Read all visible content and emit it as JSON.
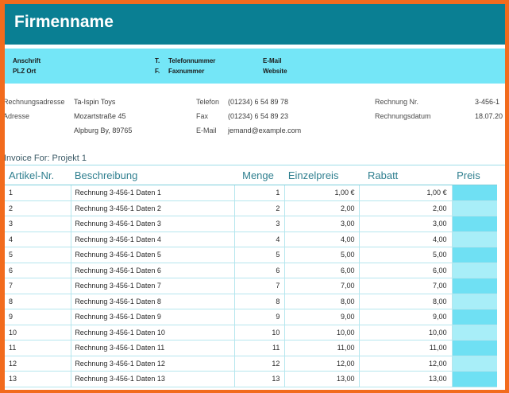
{
  "header": {
    "company_name": "Firmenname"
  },
  "contact": {
    "anschrift": "Anschrift",
    "plz_ort": "PLZ Ort",
    "t_label": "T.",
    "telefonnummer": "Telefonnummer",
    "f_label": "F.",
    "faxnummer": "Faxnummer",
    "email": "E-Mail",
    "website": "Website"
  },
  "billing": {
    "rechnungsadresse_label": "Rechnungsadresse",
    "adresse_label": "Adresse",
    "name": "Ta-Ispin Toys",
    "street": "Mozartstraße 45",
    "city": "Alpburg By, 89765",
    "telefon_label": "Telefon",
    "telefon_value": "(01234) 6 54 89 78",
    "fax_label": "Fax",
    "fax_value": "(01234) 6 54 89 23",
    "email_label": "E-Mail",
    "email_value": "jemand@example.com",
    "rechnung_nr_label": "Rechnung Nr.",
    "rechnung_nr_value": "3-456-1",
    "rechnungsdatum_label": "Rechnungsdatum",
    "rechnungsdatum_value": "18.07.20"
  },
  "invoice_for": "Invoice For: Projekt 1",
  "table": {
    "headers": {
      "artikel": "Artikel-Nr.",
      "beschreibung": "Beschreibung",
      "menge": "Menge",
      "einzelpreis": "Einzelpreis",
      "rabatt": "Rabatt",
      "preis": "Preis"
    },
    "rows": [
      {
        "nr": "1",
        "desc": "Rechnung 3-456-1 Daten 1",
        "menge": "1",
        "einzel": "1,00 €",
        "rabatt": "1,00 €"
      },
      {
        "nr": "2",
        "desc": "Rechnung 3-456-1 Daten 2",
        "menge": "2",
        "einzel": "2,00",
        "rabatt": "2,00"
      },
      {
        "nr": "3",
        "desc": "Rechnung 3-456-1 Daten 3",
        "menge": "3",
        "einzel": "3,00",
        "rabatt": "3,00"
      },
      {
        "nr": "4",
        "desc": "Rechnung 3-456-1 Daten 4",
        "menge": "4",
        "einzel": "4,00",
        "rabatt": "4,00"
      },
      {
        "nr": "5",
        "desc": "Rechnung 3-456-1 Daten 5",
        "menge": "5",
        "einzel": "5,00",
        "rabatt": "5,00"
      },
      {
        "nr": "6",
        "desc": "Rechnung 3-456-1 Daten 6",
        "menge": "6",
        "einzel": "6,00",
        "rabatt": "6,00"
      },
      {
        "nr": "7",
        "desc": "Rechnung 3-456-1 Daten 7",
        "menge": "7",
        "einzel": "7,00",
        "rabatt": "7,00"
      },
      {
        "nr": "8",
        "desc": "Rechnung 3-456-1 Daten 8",
        "menge": "8",
        "einzel": "8,00",
        "rabatt": "8,00"
      },
      {
        "nr": "9",
        "desc": "Rechnung 3-456-1 Daten 9",
        "menge": "9",
        "einzel": "9,00",
        "rabatt": "9,00"
      },
      {
        "nr": "10",
        "desc": "Rechnung 3-456-1 Daten 10",
        "menge": "10",
        "einzel": "10,00",
        "rabatt": "10,00"
      },
      {
        "nr": "11",
        "desc": "Rechnung 3-456-1 Daten 11",
        "menge": "11",
        "einzel": "11,00",
        "rabatt": "11,00"
      },
      {
        "nr": "12",
        "desc": "Rechnung 3-456-1 Daten 12",
        "menge": "12",
        "einzel": "12,00",
        "rabatt": "12,00"
      },
      {
        "nr": "13",
        "desc": "Rechnung 3-456-1 Daten 13",
        "menge": "13",
        "einzel": "13,00",
        "rabatt": "13,00"
      }
    ]
  },
  "colors": {
    "header_bg": "#0a7f93",
    "contact_bg": "#74e6f7",
    "frame": "#f26b1d",
    "price_col": "#6fe0f3"
  }
}
